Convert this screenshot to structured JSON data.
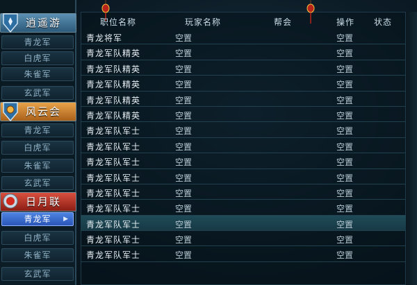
{
  "sidebar": {
    "guilds": [
      {
        "name": "逍遥游",
        "style": "blue",
        "subs": [
          "青龙军",
          "白虎军",
          "朱雀军",
          "玄武军"
        ]
      },
      {
        "name": "风云会",
        "style": "orange",
        "subs": [
          "青龙军",
          "白虎军",
          "朱雀军",
          "玄武军"
        ]
      },
      {
        "name": "日月联",
        "style": "red",
        "subs": [
          "青龙军",
          "白虎军",
          "朱雀军",
          "玄武军"
        ],
        "active_sub": 0
      }
    ]
  },
  "table": {
    "columns": [
      "职位名称",
      "玩家名称",
      "帮会",
      "操作",
      "状态"
    ],
    "rows": [
      {
        "position": "青龙将军",
        "player": "空置",
        "action": "空置"
      },
      {
        "position": "青龙军队精英",
        "player": "空置",
        "action": "空置"
      },
      {
        "position": "青龙军队精英",
        "player": "空置",
        "action": "空置"
      },
      {
        "position": "青龙军队精英",
        "player": "空置",
        "action": "空置"
      },
      {
        "position": "青龙军队精英",
        "player": "空置",
        "action": "空置"
      },
      {
        "position": "青龙军队精英",
        "player": "空置",
        "action": "空置"
      },
      {
        "position": "青龙军队军士",
        "player": "空置",
        "action": "空置"
      },
      {
        "position": "青龙军队军士",
        "player": "空置",
        "action": "空置"
      },
      {
        "position": "青龙军队军士",
        "player": "空置",
        "action": "空置"
      },
      {
        "position": "青龙军队军士",
        "player": "空置",
        "action": "空置"
      },
      {
        "position": "青龙军队军士",
        "player": "空置",
        "action": "空置"
      },
      {
        "position": "青龙军队军士",
        "player": "空置",
        "action": "空置"
      },
      {
        "position": "青龙军队军士",
        "player": "空置",
        "action": "空置"
      },
      {
        "position": "青龙军队军士",
        "player": "空置",
        "action": "空置"
      },
      {
        "position": "青龙军队军士",
        "player": "空置",
        "action": "空置"
      }
    ],
    "selected_row": 12
  },
  "colors": {
    "accent_blue": "#4d82e0",
    "guild_orange": "#e8a34a",
    "guild_red": "#d8503f"
  }
}
